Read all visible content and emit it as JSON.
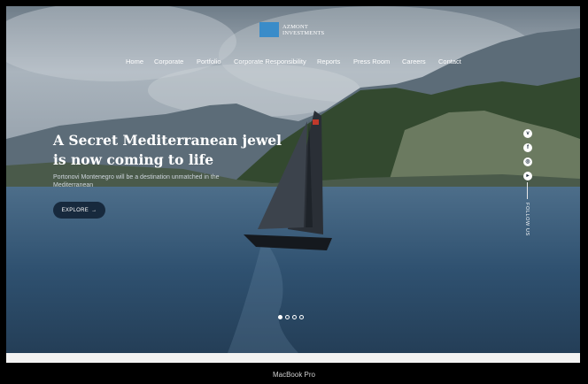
{
  "brand": {
    "line1": "AZMONT",
    "line2": "INVESTMENTS"
  },
  "nav": [
    "Home",
    "Corporate",
    "Portfolio",
    "Corporate Responsibility",
    "Reports",
    "Press Room",
    "Careers",
    "Contact"
  ],
  "hero": {
    "headline_line1": "A Secret Mediterranean jewel",
    "headline_line2": "is now coming to life",
    "subtext": "Portonovi Montenegro will be a destination unmatched in the Mediterranean",
    "cta_label": "EXPLORE",
    "cta_arrow": "→"
  },
  "social": {
    "icons": [
      "vimeo-icon",
      "facebook-icon",
      "instagram-icon",
      "youtube-icon"
    ],
    "follow_label": "FOLLOW US"
  },
  "slider": {
    "total": 4,
    "active": 1
  },
  "device_label": "MacBook Pro",
  "colors": {
    "button_bg": "#17293d",
    "logo_accent": "#3a8cc9",
    "sea": "#2f5170",
    "sky": "#9aa6b1"
  }
}
